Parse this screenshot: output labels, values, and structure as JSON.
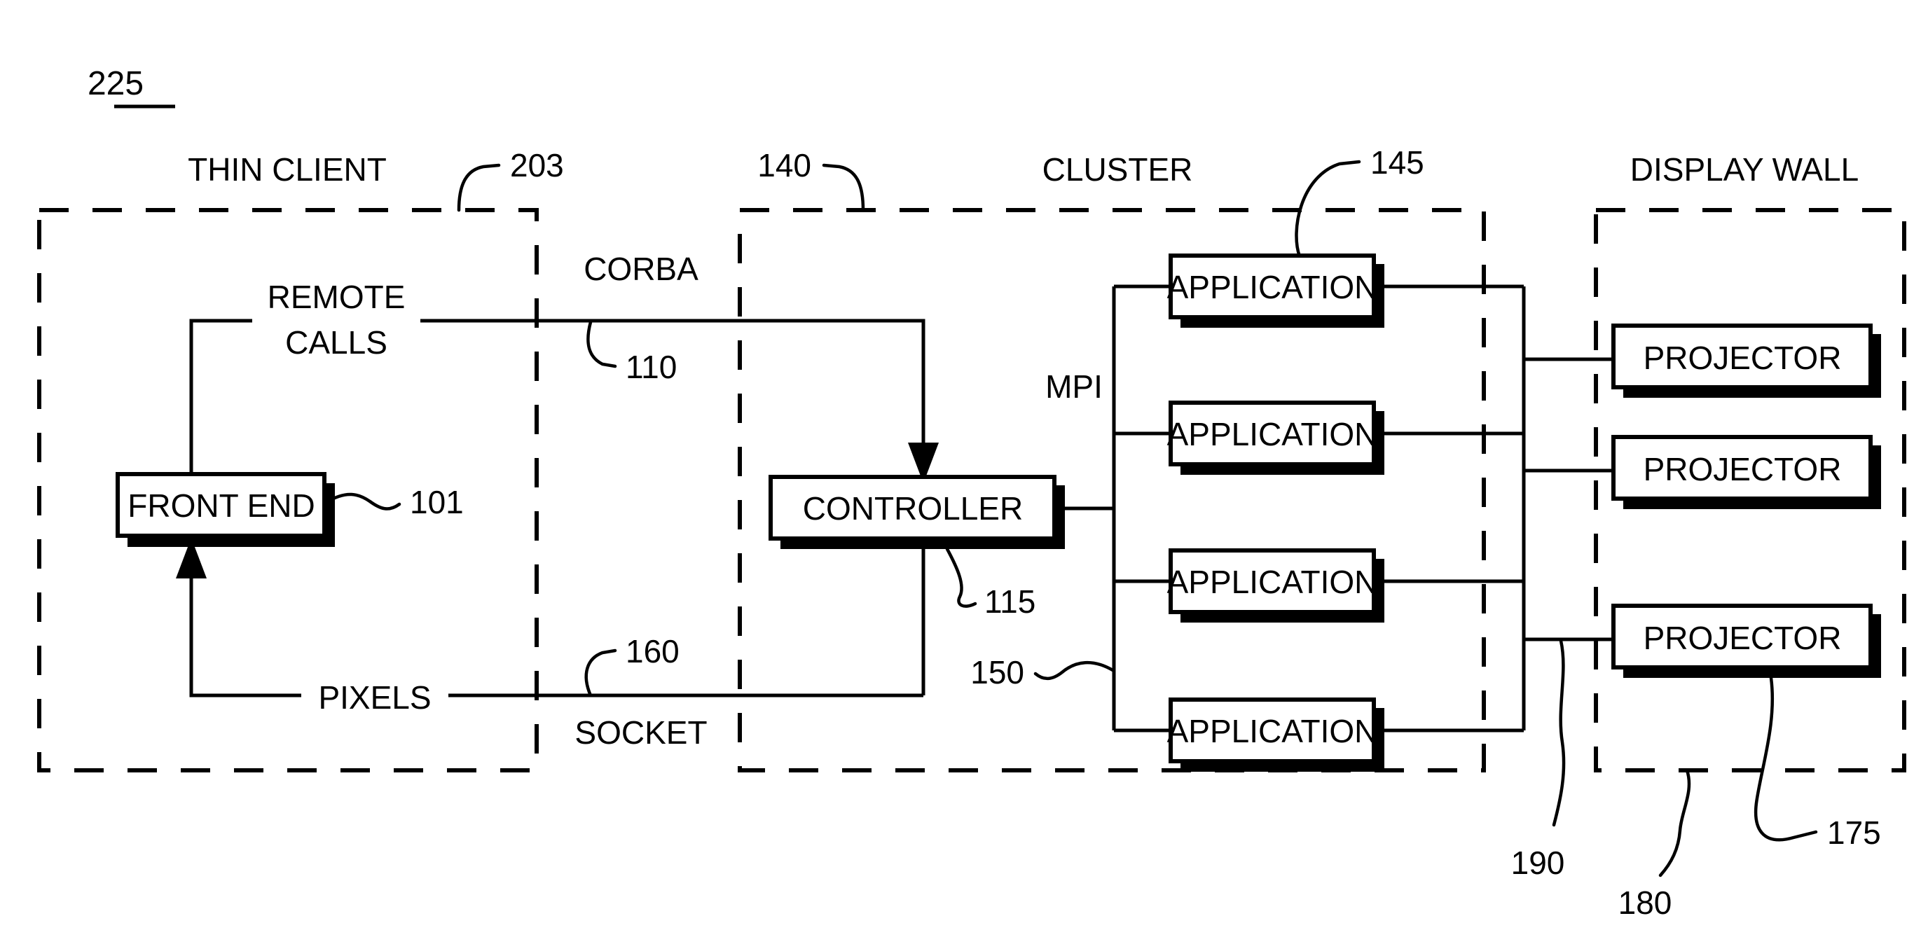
{
  "figure": {
    "number": "225"
  },
  "zones": [
    {
      "key": "thin_client",
      "label": "THIN CLIENT",
      "ref": "203"
    },
    {
      "key": "cluster_zone",
      "label": "CLUSTER",
      "ref": "140"
    },
    {
      "key": "display_wall",
      "label": "DISPLAY WALL",
      "ref": null
    }
  ],
  "zone_titles": {
    "thin_client": "THIN CLIENT",
    "cluster": "CLUSTER",
    "display_wall": "DISPLAY WALL"
  },
  "boxes": {
    "front_end": {
      "label": "FRONT END",
      "ref": "101"
    },
    "controller": {
      "label": "CONTROLLER",
      "ref": "115"
    },
    "applications": [
      {
        "label": "APPLICATION",
        "ref": "145"
      },
      {
        "label": "APPLICATION",
        "ref": null
      },
      {
        "label": "APPLICATION",
        "ref": null
      },
      {
        "label": "APPLICATION",
        "ref": null
      }
    ],
    "projectors": [
      {
        "label": "PROJECTOR",
        "ref": null
      },
      {
        "label": "PROJECTOR",
        "ref": null
      },
      {
        "label": "PROJECTOR",
        "ref": "175"
      }
    ]
  },
  "connections": {
    "remote_calls_line1": "REMOTE",
    "remote_calls_line2": "CALLS",
    "corba": "CORBA",
    "pixels": "PIXELS",
    "socket": "SOCKET",
    "mpi": "MPI"
  },
  "reference_numerals": {
    "fig": "225",
    "thin_client_boundary": "203",
    "corba_link": "110",
    "front_end": "101",
    "cluster_boundary": "140",
    "controller": "115",
    "application": "145",
    "mpi_bus": "150",
    "socket_link": "160",
    "display_bus": "190",
    "display_wall_boundary": "180",
    "projector": "175"
  },
  "colors": {
    "ink": "#000000",
    "paper": "#ffffff"
  }
}
